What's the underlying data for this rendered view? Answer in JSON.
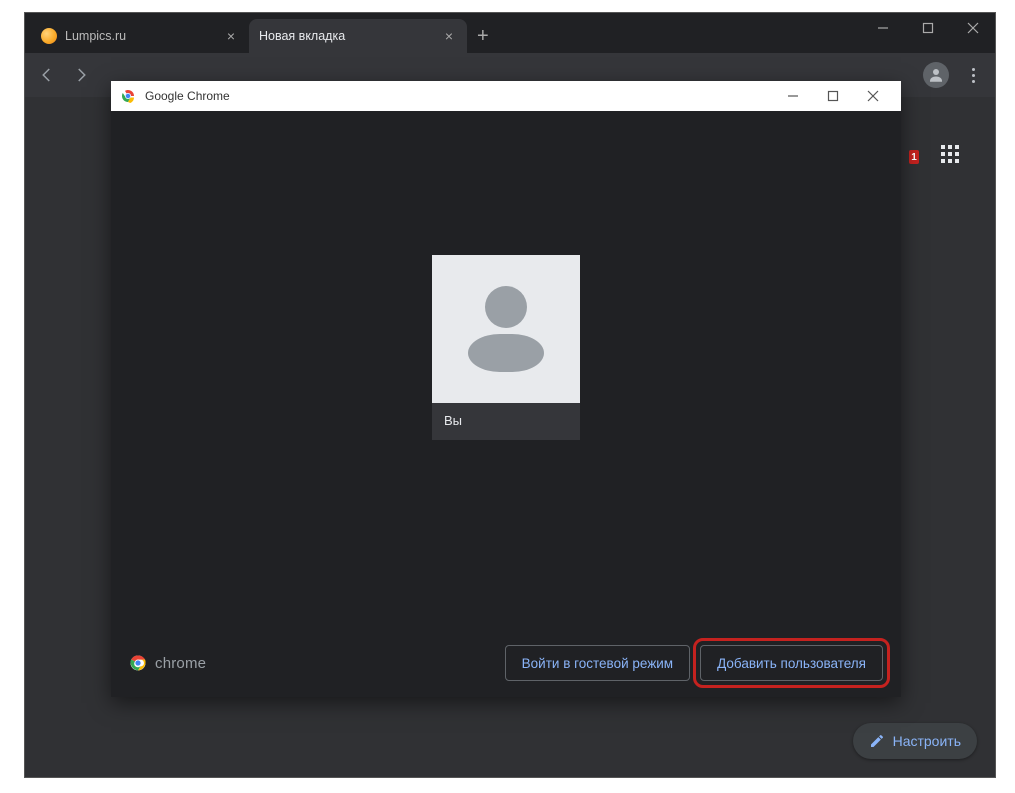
{
  "tabs": [
    {
      "title": "Lumpics.ru",
      "active": false
    },
    {
      "title": "Новая вкладка",
      "active": true
    }
  ],
  "window_controls": {
    "minimize": "minimize",
    "maximize": "maximize",
    "close": "close"
  },
  "toolbar": {
    "back": "back",
    "forward": "forward"
  },
  "content": {
    "apps_tooltip": "Приложения",
    "customize_label": "Настроить",
    "badge_peek": "1"
  },
  "dialog": {
    "title": "Google Chrome",
    "profile": {
      "name": "Вы"
    },
    "footer": {
      "brand": "chrome",
      "guest_button": "Войти в гостевой режим",
      "add_user_button": "Добавить пользователя"
    }
  }
}
